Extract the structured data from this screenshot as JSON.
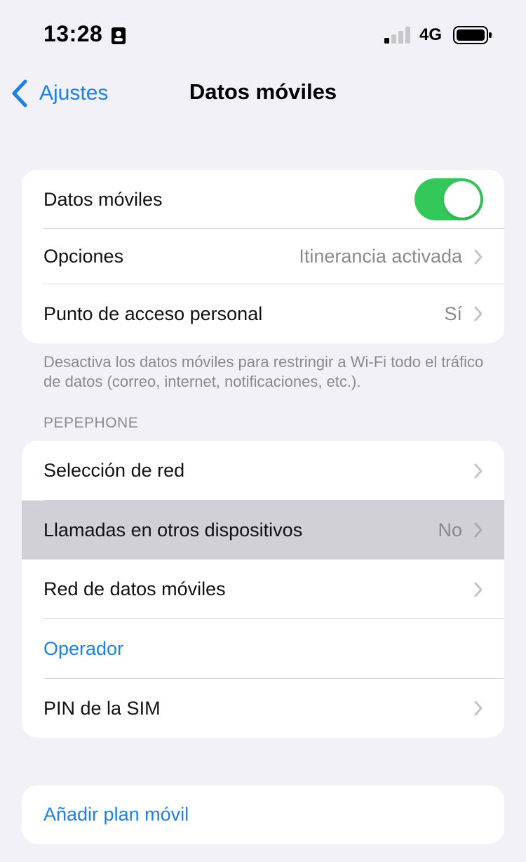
{
  "status_bar": {
    "time": "13:28",
    "network": "4G",
    "focus_icon": "person-card-icon",
    "signal_icon": "cellular-signal-icon",
    "battery_icon": "battery-icon"
  },
  "nav": {
    "back_label": "Ajustes",
    "back_icon": "chevron-left-icon",
    "title": "Datos móviles"
  },
  "group1": {
    "rows": [
      {
        "label": "Datos móviles",
        "toggle": true
      },
      {
        "label": "Opciones",
        "value": "Itinerancia activada"
      },
      {
        "label": "Punto de acceso personal",
        "value": "Sí"
      }
    ],
    "footnote": "Desactiva los datos móviles para restringir a Wi-Fi todo el tráfico de datos (correo, internet, notificaciones, etc.)."
  },
  "group2": {
    "header": "PEPEPHONE",
    "rows": [
      {
        "label": "Selección de red",
        "value": ""
      },
      {
        "label": "Llamadas en otros dispositivos",
        "value": "No",
        "highlighted": true
      },
      {
        "label": "Red de datos móviles",
        "value": ""
      },
      {
        "label": "Operador",
        "link": true
      },
      {
        "label": "PIN de la SIM",
        "value": ""
      }
    ]
  },
  "group3": {
    "rows": [
      {
        "label": "Añadir plan móvil",
        "link": true
      }
    ]
  },
  "colors": {
    "background": "#F2F1F7",
    "accent": "#1C80E5",
    "toggle_on": "#34C759",
    "secondary_text": "#8A8A8E",
    "highlight": "#D1D0D6"
  }
}
